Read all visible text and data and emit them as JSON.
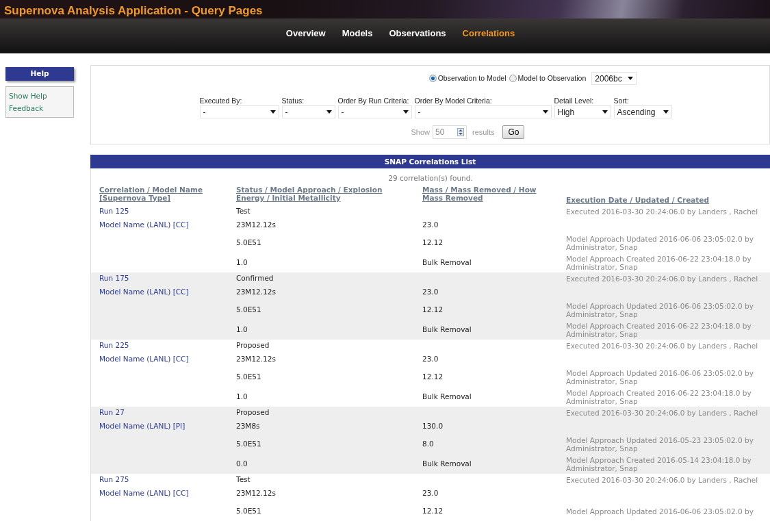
{
  "header": {
    "title": "Supernova Analysis Application - Query Pages",
    "nav": [
      {
        "label": "Overview",
        "selected": false
      },
      {
        "label": "Models",
        "selected": false
      },
      {
        "label": "Observations",
        "selected": false
      },
      {
        "label": "Correlations",
        "selected": true
      }
    ]
  },
  "sidebar": {
    "title": "Help",
    "links": [
      "Show Help",
      "Feedback"
    ]
  },
  "filters": {
    "direction": [
      {
        "label": "Observation to Model",
        "selected": true
      },
      {
        "label": "Model to Observation",
        "selected": false
      }
    ],
    "supernova": "2006bc",
    "fields": [
      {
        "label": "Executed By:",
        "value": "-"
      },
      {
        "label": "Status:",
        "value": "-"
      },
      {
        "label": "Order By Run Criteria:",
        "value": "-"
      },
      {
        "label": "Order By Model Criteria:",
        "value": "-"
      },
      {
        "label": "Detail Level:",
        "value": "High"
      },
      {
        "label": "Sort:",
        "value": "Ascending"
      }
    ],
    "show_label": "Show",
    "count": "50",
    "results_label": "results",
    "go": "Go"
  },
  "list": {
    "title": "SNAP Correlations List",
    "summary": "29 correlation(s) found.",
    "columns": [
      "Correlation / Model Name [Supernova Type]",
      "Status / Model Approach / Explosion Energy / Initial Metallicity",
      "Mass / Mass Removed / How Mass Removed",
      "Execution Date / Updated / Created"
    ],
    "records": [
      {
        "run": "Run 125",
        "model": "Model Name (LANL) [CC]",
        "status": "Test",
        "approach": "23M12.12s",
        "energy": "5.0E51",
        "metallicity": "1.0",
        "mass": "23.0",
        "mass_removed": "12.12",
        "how_removed": "Bulk Removal",
        "executed": "Executed 2016-03-30 20:24:06.0 by Landers , Rachel",
        "updated": "Model Approach Updated 2016-06-06 23:05:02.0 by Administrator, Snap",
        "created": "Model Approach Created 2016-06-22 23:04:18.0 by Administrator, Snap"
      },
      {
        "run": "Run 175",
        "model": "Model Name (LANL) [CC]",
        "status": "Confirmed",
        "approach": "23M12.12s",
        "energy": "5.0E51",
        "metallicity": "1.0",
        "mass": "23.0",
        "mass_removed": "12.12",
        "how_removed": "Bulk Removal",
        "executed": "Executed 2016-03-30 20:24:06.0 by Landers , Rachel",
        "updated": "Model Approach Updated 2016-06-06 23:05:02.0 by Administrator, Snap",
        "created": "Model Approach Created 2016-06-22 23:04:18.0 by Administrator, Snap"
      },
      {
        "run": "Run 225",
        "model": "Model Name (LANL) [CC]",
        "status": "Proposed",
        "approach": "23M12.12s",
        "energy": "5.0E51",
        "metallicity": "1.0",
        "mass": "23.0",
        "mass_removed": "12.12",
        "how_removed": "Bulk Removal",
        "executed": "Executed 2016-03-30 20:24:06.0 by Landers , Rachel",
        "updated": "Model Approach Updated 2016-06-06 23:05:02.0 by Administrator, Snap",
        "created": "Model Approach Created 2016-06-22 23:04:18.0 by Administrator, Snap"
      },
      {
        "run": "Run 27",
        "model": "Model Name (LANL) [PI]",
        "status": "Proposed",
        "approach": "23M8s",
        "energy": "5.0E51",
        "metallicity": "0.0",
        "mass": "130.0",
        "mass_removed": "8.0",
        "how_removed": "Bulk Removal",
        "executed": "Executed 2016-03-30 20:24:06.0 by Landers , Rachel",
        "updated": "Model Approach Updated 2016-05-23 23:05:02.0 by Administrator, Snap",
        "created": "Model Approach Created 2016-05-14 23:04:18.0 by Administrator, Snap"
      },
      {
        "run": "Run 275",
        "model": "Model Name (LANL) [CC]",
        "status": "Test",
        "approach": "23M12.12s",
        "energy": "5.0E51",
        "mass": "23.0",
        "mass_removed": "12.12",
        "executed": "Executed 2016-03-30 20:24:06.0 by Landers , Rachel",
        "updated": "Model Approach Updated 2016-06-06 23:05:02.0 by"
      }
    ]
  }
}
